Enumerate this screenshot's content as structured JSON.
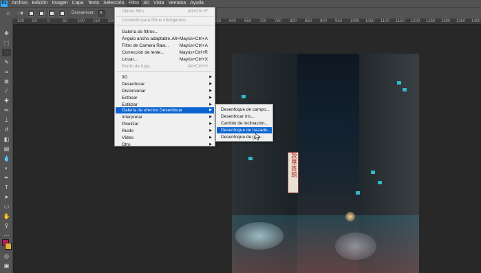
{
  "app": {
    "logo": "Ps"
  },
  "menubar": [
    {
      "label": "Archivo"
    },
    {
      "label": "Edición"
    },
    {
      "label": "Imagen"
    },
    {
      "label": "Capa"
    },
    {
      "label": "Texto"
    },
    {
      "label": "Selección"
    },
    {
      "label": "Filtro"
    },
    {
      "label": "3D"
    },
    {
      "label": "Vista"
    },
    {
      "label": "Ventana"
    },
    {
      "label": "Ayuda"
    }
  ],
  "options_bar": {
    "feather_label": "Desvanecer:",
    "feather_value": "0 px"
  },
  "ruler": {
    "ticks": [
      "100",
      "50",
      "0",
      "50",
      "100",
      "150",
      "200",
      "250",
      "300",
      "350",
      "400",
      "450",
      "500",
      "550",
      "600",
      "650",
      "700",
      "750",
      "800",
      "850",
      "900",
      "950",
      "1000",
      "1050",
      "1100",
      "1150",
      "1200",
      "1250",
      "1300",
      "1350",
      "1400"
    ]
  },
  "colors": {
    "foreground": "#c2185b",
    "background": "#e3b23c",
    "menu_highlight": "#0a64d0"
  },
  "filter_menu": {
    "items": [
      {
        "label": "Último filtro",
        "shortcut": "Alt+Ctrl+F",
        "disabled": true
      },
      {
        "label": "Convertir para filtros inteligentes",
        "disabled": true
      },
      {
        "label": "Galería de filtros..."
      },
      {
        "label": "Ángulo ancho adaptable...",
        "shortcut": "Alt+Mayús+Ctrl+A"
      },
      {
        "label": "Filtro de Camera Raw...",
        "shortcut": "Mayús+Ctrl+A"
      },
      {
        "label": "Corrección de lente...",
        "shortcut": "Mayús+Ctrl+R"
      },
      {
        "label": "Licuar...",
        "shortcut": "Mayús+Ctrl+X"
      },
      {
        "label": "Punto de fuga...",
        "shortcut": "Alt+Ctrl+V",
        "disabled": true
      },
      {
        "label": "3D"
      },
      {
        "label": "Desenfocar"
      },
      {
        "label": "Distorsionar"
      },
      {
        "label": "Enfocar"
      },
      {
        "label": "Estilizar"
      },
      {
        "label": "Galería de efectos Desenfocar"
      },
      {
        "label": "Interpretar"
      },
      {
        "label": "Pixelizar"
      },
      {
        "label": "Ruido"
      },
      {
        "label": "Vídeo"
      },
      {
        "label": "Otro"
      }
    ]
  },
  "blur_gallery_submenu": {
    "items": [
      {
        "label": "Desenfoque de campo..."
      },
      {
        "label": "Desenfocar iris..."
      },
      {
        "label": "Cambio de inclinación..."
      },
      {
        "label": "Desenfoque de trazado..."
      },
      {
        "label": "Desenfoque de giro..."
      }
    ]
  },
  "photo": {
    "sign_text": "敦華賓館"
  }
}
